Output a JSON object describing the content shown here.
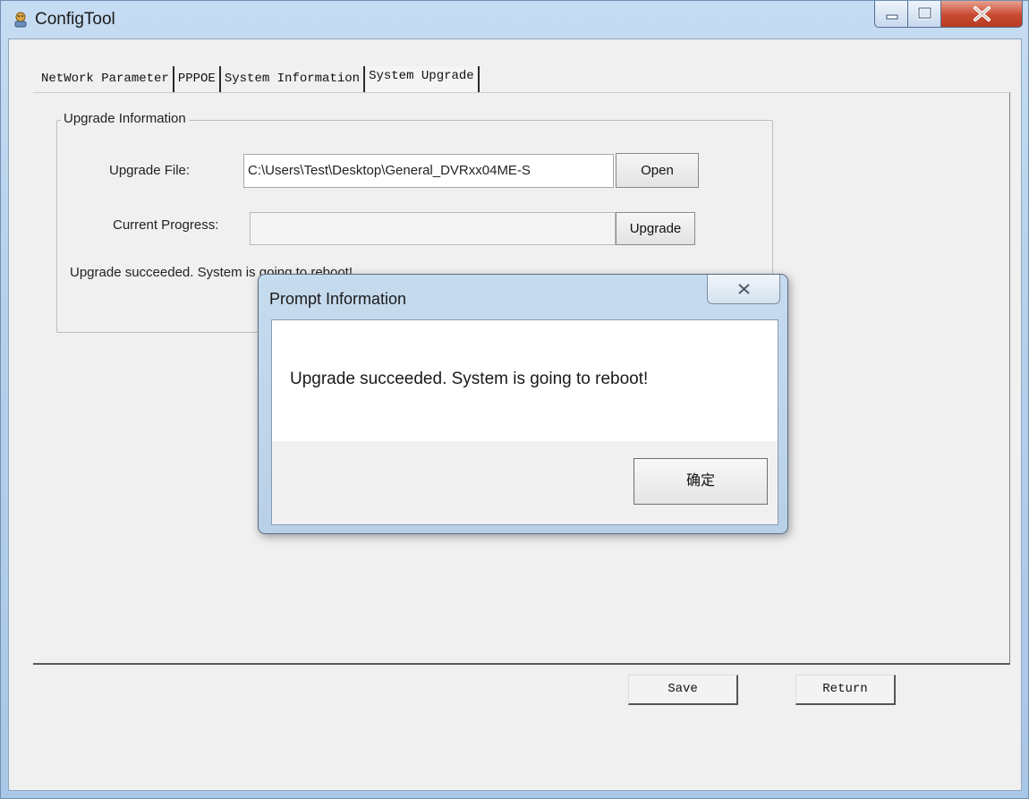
{
  "window": {
    "title": "ConfigTool",
    "icon": "app-icon"
  },
  "tabs": [
    {
      "label": "NetWork Parameter",
      "active": false
    },
    {
      "label": "PPPOE",
      "active": false
    },
    {
      "label": "System Information",
      "active": false
    },
    {
      "label": "System Upgrade",
      "active": true
    }
  ],
  "upgrade": {
    "group_label": "Upgrade Information",
    "file_label": "Upgrade File:",
    "file_value": "C:\\Users\\Test\\Desktop\\General_DVRxx04ME-S",
    "open_label": "Open",
    "progress_label": "Current Progress:",
    "progress_value": 0,
    "upgrade_label": "Upgrade",
    "status_text": "Upgrade succeeded. System is going to reboot!"
  },
  "footer": {
    "save_label": "Save",
    "return_label": "Return"
  },
  "dialog": {
    "title": "Prompt Information",
    "message": "Upgrade succeeded. System is going to reboot!",
    "ok_label": "确定"
  },
  "colors": {
    "frame": "#b5d0eb",
    "close_button": "#c94a31",
    "client_bg": "#f0f0f0"
  }
}
